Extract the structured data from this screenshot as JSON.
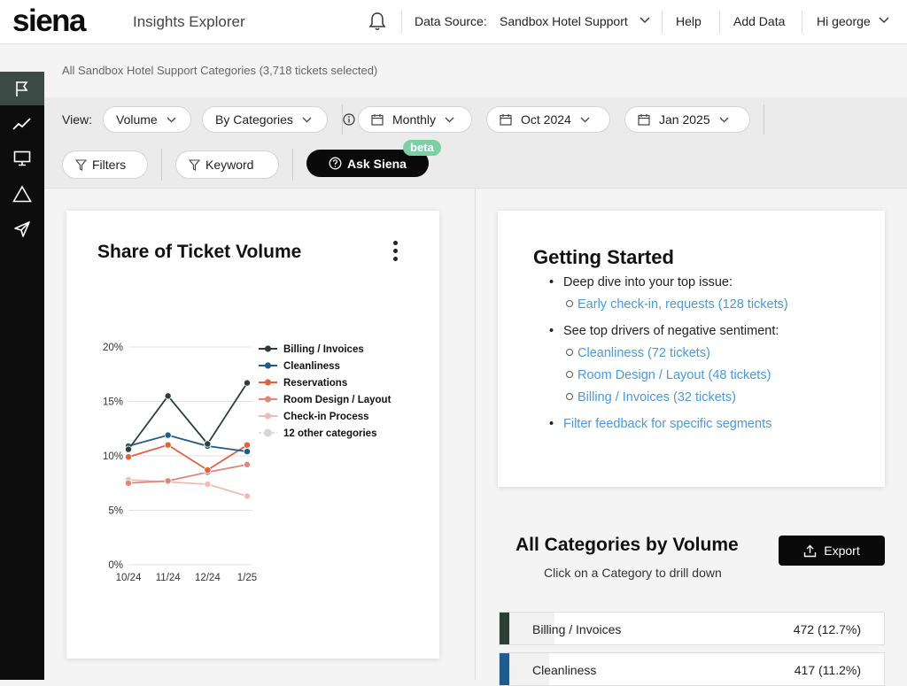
{
  "brand": {
    "logo": "siena",
    "app_title": "Insights Explorer"
  },
  "header": {
    "data_source_label": "Data Source:",
    "data_source_value": "Sandbox Hotel Support",
    "help": "Help",
    "add_data": "Add Data",
    "user": "Hi george"
  },
  "sidebar": {
    "items": [
      {
        "icon": "flag-icon",
        "active": true
      },
      {
        "icon": "trend-line-icon",
        "active": false
      },
      {
        "icon": "monitor-icon",
        "active": false
      },
      {
        "icon": "triangle-alert-icon",
        "active": false
      },
      {
        "icon": "send-icon",
        "active": false
      }
    ]
  },
  "selection_text": "All Sandbox Hotel Support Categories (3,718 tickets selected)",
  "toolbar": {
    "view_label": "View:",
    "view_metric": "Volume",
    "view_grouping": "By Categories",
    "interval": "Monthly",
    "start_month": "Oct 2024",
    "end_month": "Jan 2025",
    "filters": "Filters",
    "keyword": "Keyword",
    "ask": "Ask Siena",
    "beta": "beta"
  },
  "share_card": {
    "title": "Share of Ticket Volume"
  },
  "chart_data": {
    "type": "line",
    "title": "Share of Ticket Volume",
    "x": [
      "10/24",
      "11/24",
      "12/24",
      "1/25"
    ],
    "y_ticks": [
      "0%",
      "5%",
      "10%",
      "15%",
      "20%"
    ],
    "ylim": [
      0,
      20
    ],
    "grid": true,
    "legend_position": "right",
    "series": [
      {
        "name": "Billing / Invoices",
        "color": "#2c3e35",
        "values": [
          10.6,
          15.5,
          11.1,
          16.7
        ]
      },
      {
        "name": "Cleanliness",
        "color": "#1f5b8c",
        "values": [
          10.9,
          11.9,
          10.9,
          10.4
        ]
      },
      {
        "name": "Reservations",
        "color": "#e4603f",
        "values": [
          9.9,
          11.0,
          8.7,
          11.0
        ]
      },
      {
        "name": "Room Design / Layout",
        "color": "#e0877a",
        "values": [
          7.5,
          7.7,
          8.5,
          9.2
        ]
      },
      {
        "name": "Check-in Process",
        "color": "#efbcb3",
        "values": [
          7.8,
          7.6,
          7.4,
          6.3
        ]
      },
      {
        "name": "12 other categories",
        "color": "#d5d5d5",
        "values": []
      }
    ]
  },
  "getting_started": {
    "title": "Getting Started",
    "item1": "Deep dive into your top issue:",
    "item1_link": "Early check-in, requests (128 tickets)",
    "item2": "See top drivers of negative sentiment:",
    "item2_links": [
      "Cleanliness (72 tickets)",
      "Room Design / Layout (48 tickets)",
      "Billing / Invoices (32 tickets)"
    ],
    "item3_link": "Filter feedback for specific segments"
  },
  "categories": {
    "title": "All Categories by Volume",
    "subtitle": "Click on a Category to drill down",
    "export": "Export",
    "rows": [
      {
        "name": "Billing / Invoices",
        "value": "472 (12.7%)",
        "share": 0.127,
        "color": "#2c3e35"
      },
      {
        "name": "Cleanliness",
        "value": "417 (11.2%)",
        "share": 0.112,
        "color": "#1f5b8c"
      }
    ]
  }
}
